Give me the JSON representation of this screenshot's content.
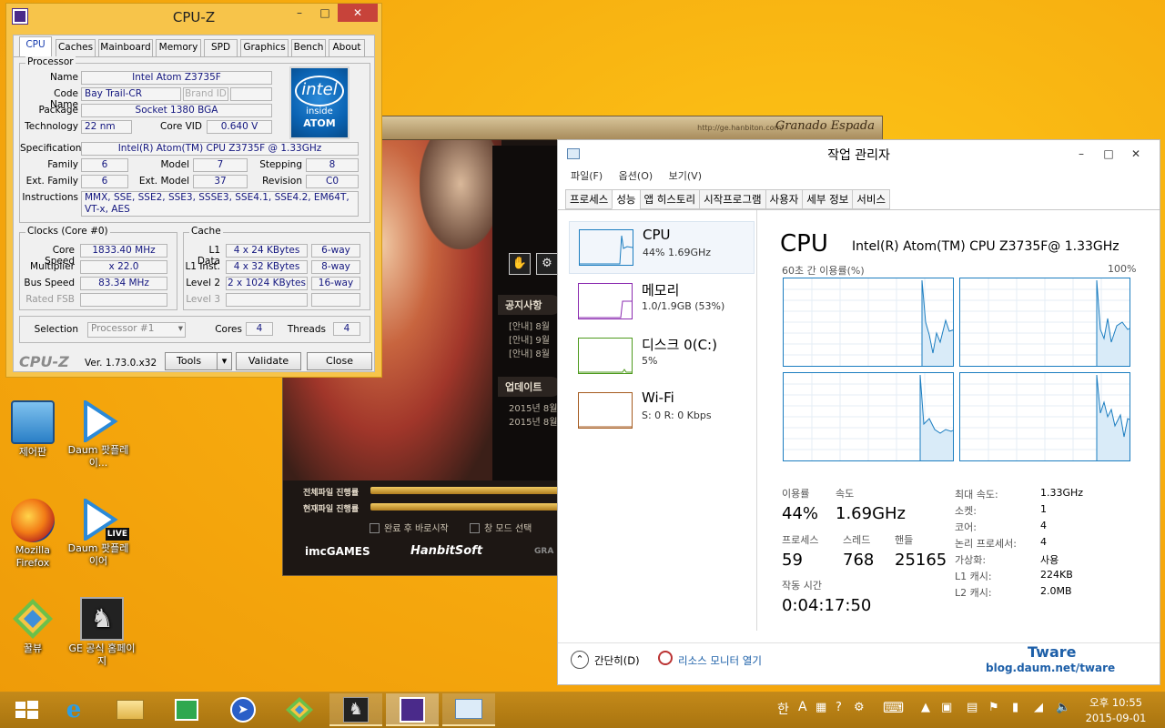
{
  "game": {
    "url": "http://ge.hanbiton.com/",
    "brand": "Granado Espada",
    "notice_title": "공지사항",
    "notices": [
      "[안내] 8월",
      "[안내] 9월",
      "[안내] 8월"
    ],
    "update_title": "업데이트",
    "updates": [
      "2015년 8월",
      "2015년 8월"
    ],
    "bar1_label": "전체파일 진행률",
    "bar2_label": "현재파일 진행률",
    "check1": "완료 후 바로시작",
    "check2": "창 모드 선택",
    "logo1": "imcGAMES",
    "logo2": "HanbitSoft",
    "logo3": "GRA"
  },
  "cpuz": {
    "title": "CPU-Z",
    "tabs": [
      "CPU",
      "Caches",
      "Mainboard",
      "Memory",
      "SPD",
      "Graphics",
      "Bench",
      "About"
    ],
    "processor": {
      "legend": "Processor",
      "name_label": "Name",
      "name": "Intel Atom Z3735F",
      "codename_label": "Code Name",
      "codename": "Bay Trail-CR",
      "brandid_label": "Brand ID",
      "package_label": "Package",
      "package": "Socket 1380 BGA",
      "tech_label": "Technology",
      "tech": "22 nm",
      "vid_label": "Core VID",
      "vid": "0.640 V",
      "spec_label": "Specification",
      "spec": "Intel(R) Atom(TM) CPU  Z3735F @ 1.33GHz",
      "family_label": "Family",
      "family": "6",
      "model_label": "Model",
      "model": "7",
      "stepping_label": "Stepping",
      "stepping": "8",
      "extfamily_label": "Ext. Family",
      "extfamily": "6",
      "extmodel_label": "Ext. Model",
      "extmodel": "37",
      "revision_label": "Revision",
      "revision": "C0",
      "instr_label": "Instructions",
      "instr": "MMX, SSE, SSE2, SSE3, SSSE3, SSE4.1, SSE4.2, EM64T, VT-x, AES"
    },
    "intel": {
      "brand": "intel",
      "inside": "inside",
      "product": "ATOM"
    },
    "clocks": {
      "legend": "Clocks (Core #0)",
      "speed_label": "Core Speed",
      "speed": "1833.40 MHz",
      "mult_label": "Multiplier",
      "mult": "x 22.0",
      "bus_label": "Bus Speed",
      "bus": "83.34 MHz",
      "fsb_label": "Rated FSB"
    },
    "cache": {
      "legend": "Cache",
      "l1d_label": "L1 Data",
      "l1d": "4 x 24 KBytes",
      "l1d_way": "6-way",
      "l1i_label": "L1 Inst.",
      "l1i": "4 x 32 KBytes",
      "l1i_way": "8-way",
      "l2_label": "Level 2",
      "l2": "2 x 1024 KBytes",
      "l2_way": "16-way",
      "l3_label": "Level 3"
    },
    "selection_label": "Selection",
    "selection": "Processor #1",
    "cores_label": "Cores",
    "cores": "4",
    "threads_label": "Threads",
    "threads": "4",
    "footer_logo": "CPU-Z",
    "version": "Ver. 1.73.0.x32",
    "tools": "Tools",
    "validate": "Validate",
    "close": "Close"
  },
  "tm": {
    "title": "작업 관리자",
    "menu": [
      "파일(F)",
      "옵션(O)",
      "보기(V)"
    ],
    "tabs": [
      "프로세스",
      "성능",
      "앱 히스토리",
      "시작프로그램",
      "사용자",
      "세부 정보",
      "서비스"
    ],
    "side": [
      {
        "name": "CPU",
        "sub": "44%  1.69GHz"
      },
      {
        "name": "메모리",
        "sub": "1.0/1.9GB (53%)"
      },
      {
        "name": "디스크 0(C:)",
        "sub": "5%"
      },
      {
        "name": "Wi-Fi",
        "sub": "S: 0  R: 0 Kbps"
      }
    ],
    "heading": "CPU",
    "model": "Intel(R) Atom(TM) CPU Z3735F@ 1.33GHz",
    "graph_label": "60초 간 이용률(%)",
    "graph_max": "100%",
    "util_label": "이용률",
    "util": "44%",
    "speed_label": "속도",
    "speed": "1.69GHz",
    "proc_label": "프로세스",
    "proc": "59",
    "threads_label": "스레드",
    "threads": "768",
    "handles_label": "핸들",
    "handles": "25165",
    "uptime_label": "작동 시간",
    "uptime": "0:04:17:50",
    "specs": [
      {
        "k": "최대 속도:",
        "v": "1.33GHz"
      },
      {
        "k": "소켓:",
        "v": "1"
      },
      {
        "k": "코어:",
        "v": "4"
      },
      {
        "k": "논리 프로세서:",
        "v": "4"
      },
      {
        "k": "가상화:",
        "v": "사용"
      },
      {
        "k": "L1 캐시:",
        "v": "224KB"
      },
      {
        "k": "L2 캐시:",
        "v": "2.0MB"
      }
    ],
    "fewer": "간단히(D)",
    "resmon": "리소스 모니터 열기",
    "wm_title": "Tware",
    "wm_url": "blog.daum.net/tware"
  },
  "desktop": [
    {
      "label": "제어판"
    },
    {
      "label": "Daum 팟플레이..."
    },
    {
      "label": "Mozilla Firefox"
    },
    {
      "label": "Daum 팟플레이어",
      "badge": "LIVE"
    },
    {
      "label": "꿀뷰"
    },
    {
      "label": "GE 공식 홈페이지"
    }
  ],
  "taskbar": {
    "ime1": "한",
    "ime2": "A",
    "time": "오후 10:55",
    "date": "2015-09-01"
  },
  "colors": {
    "accent": "#1b7dc0",
    "cpuz_frame": "#f7c44a",
    "intel_blue": "#0b64b4"
  }
}
